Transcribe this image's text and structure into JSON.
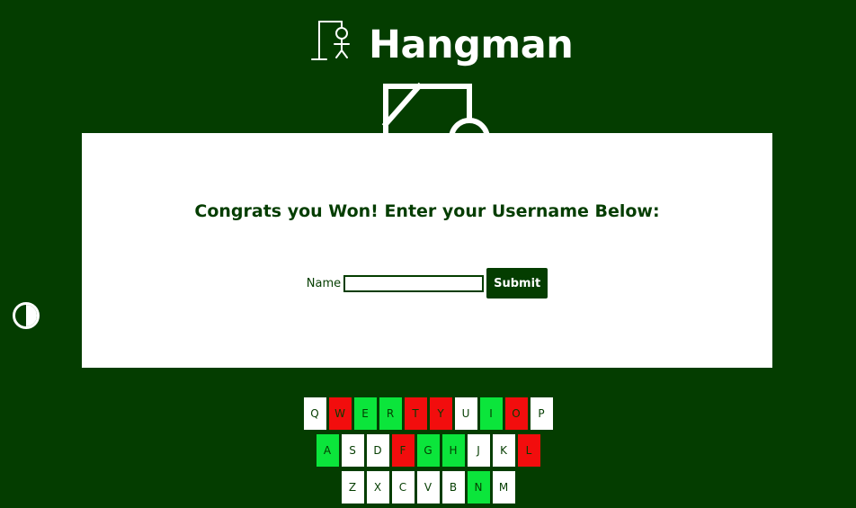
{
  "header": {
    "title": "Hangman",
    "logo_icon": "hangman-gallows-icon"
  },
  "contrast_toggle": {
    "icon": "contrast-half-circle-icon"
  },
  "modal": {
    "message": "Congrats you Won! Enter your Username Below:",
    "name_label": "Name",
    "name_value": "",
    "submit_label": "Submit"
  },
  "keyboard": {
    "rows": [
      [
        {
          "letter": "Q",
          "state": "unused"
        },
        {
          "letter": "W",
          "state": "wrong"
        },
        {
          "letter": "E",
          "state": "correct"
        },
        {
          "letter": "R",
          "state": "correct"
        },
        {
          "letter": "T",
          "state": "wrong"
        },
        {
          "letter": "Y",
          "state": "wrong"
        },
        {
          "letter": "U",
          "state": "unused"
        },
        {
          "letter": "I",
          "state": "correct"
        },
        {
          "letter": "O",
          "state": "wrong"
        },
        {
          "letter": "P",
          "state": "unused"
        }
      ],
      [
        {
          "letter": "A",
          "state": "correct"
        },
        {
          "letter": "S",
          "state": "unused"
        },
        {
          "letter": "D",
          "state": "unused"
        },
        {
          "letter": "F",
          "state": "wrong"
        },
        {
          "letter": "G",
          "state": "correct"
        },
        {
          "letter": "H",
          "state": "correct"
        },
        {
          "letter": "J",
          "state": "unused"
        },
        {
          "letter": "K",
          "state": "unused"
        },
        {
          "letter": "L",
          "state": "wrong"
        }
      ],
      [
        {
          "letter": "Z",
          "state": "unused"
        },
        {
          "letter": "X",
          "state": "unused"
        },
        {
          "letter": "C",
          "state": "unused"
        },
        {
          "letter": "V",
          "state": "unused"
        },
        {
          "letter": "B",
          "state": "unused"
        },
        {
          "letter": "N",
          "state": "correct"
        },
        {
          "letter": "M",
          "state": "unused"
        }
      ]
    ]
  },
  "colors": {
    "background": "#043d00",
    "correct": "#0be53b",
    "wrong": "#f20d0d",
    "unused": "#ffffff",
    "text": "#043d00"
  }
}
